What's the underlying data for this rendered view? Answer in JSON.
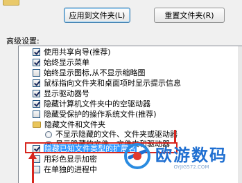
{
  "buttons": {
    "apply": "应用到文件夹(L)",
    "reset": "重置文件夹(R)"
  },
  "advanced_label": "高级设置:",
  "items": [
    {
      "type": "checkbox",
      "checked": true,
      "label": "使用共享向导(推荐)"
    },
    {
      "type": "checkbox",
      "checked": true,
      "label": "始终显示菜单"
    },
    {
      "type": "checkbox",
      "checked": false,
      "label": "始终显示图标,从不显示缩略图"
    },
    {
      "type": "checkbox",
      "checked": true,
      "label": "鼠标指向文件夹和桌面项时显示提示信息"
    },
    {
      "type": "checkbox",
      "checked": true,
      "label": "显示驱动器号"
    },
    {
      "type": "checkbox",
      "checked": true,
      "label": "隐藏计算机文件夹中的空驱动器"
    },
    {
      "type": "checkbox",
      "checked": false,
      "label": "隐藏受保护的操作系统文件(推荐)"
    },
    {
      "type": "folder",
      "label": "隐藏文件和文件夹"
    },
    {
      "type": "radio",
      "checked": false,
      "label": "不显示隐藏的文件、文件夹或驱动器"
    },
    {
      "type": "radio",
      "checked": true,
      "label": "显示隐藏的文件、文件夹和驱动器"
    },
    {
      "type": "checkbox",
      "checked": true,
      "label": "隐藏已知文件类型的扩展名",
      "selected": true
    },
    {
      "type": "checkbox",
      "checked": false,
      "label": "用彩色显示加密"
    },
    {
      "type": "checkbox",
      "checked": false,
      "label": "在单独的进程中"
    }
  ],
  "watermark": {
    "title": "欧游数码",
    "subtitle": "OYJIG572.COM"
  },
  "colors": {
    "highlight": "#3399ff",
    "annotation": "#d7261e",
    "watermark": "#1f6fd1"
  }
}
